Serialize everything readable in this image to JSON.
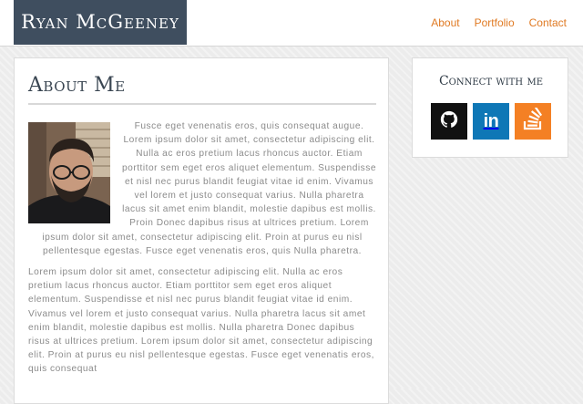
{
  "header": {
    "brand": "Ryan McGeeney",
    "nav": [
      "About",
      "Portfolio",
      "Contact"
    ]
  },
  "main": {
    "title": "About Me",
    "paragraphs": [
      "Fusce eget venenatis eros, quis consequat augue. Lorem ipsum dolor sit amet, consectetur adipiscing elit. Nulla ac eros pretium lacus rhoncus auctor. Etiam porttitor sem eget eros aliquet elementum. Suspendisse et nisl nec purus blandit feugiat vitae id enim. Vivamus vel lorem et justo consequat varius. Nulla pharetra lacus sit amet enim blandit, molestie dapibus est mollis. Proin Donec dapibus risus at ultrices pretium. Lorem ipsum dolor sit amet, consectetur adipiscing elit. Proin at purus eu nisl pellentesque egestas. Fusce eget venenatis eros, quis Nulla pharetra.",
      "Lorem ipsum dolor sit amet, consectetur adipiscing elit. Nulla ac eros pretium lacus rhoncus auctor. Etiam porttitor sem eget eros aliquet elementum. Suspendisse et nisl nec purus blandit feugiat vitae id enim. Vivamus vel lorem et justo consequat varius. Nulla pharetra lacus sit amet enim blandit, molestie dapibus est mollis. Nulla pharetra Donec dapibus risus at ultrices pretium. Lorem ipsum dolor sit amet, consectetur adipiscing elit. Proin at purus eu nisl pellentesque egestas. Fusce eget venenatis eros, quis consequat"
    ]
  },
  "sidebar": {
    "title": "Connect with me",
    "social": [
      {
        "icon": "github-icon",
        "color": "#111111"
      },
      {
        "icon": "linkedin-icon",
        "label": "in",
        "color": "#0e77b6"
      },
      {
        "icon": "stackoverflow-icon",
        "color": "#f48024"
      }
    ]
  }
}
